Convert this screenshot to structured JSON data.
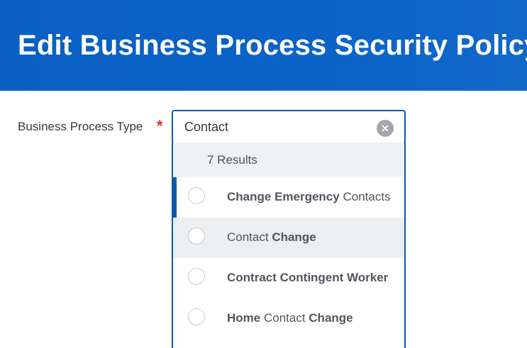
{
  "header": {
    "title": "Edit Business Process Security Policy"
  },
  "form": {
    "field_label": "Business Process Type",
    "required_marker": "*",
    "input_value": "Contact"
  },
  "dropdown": {
    "results_count": "7 Results",
    "options": [
      {
        "parts": [
          {
            "t": "Change Emergency",
            "bold": true
          },
          {
            "t": " Contacts",
            "bold": false
          }
        ]
      },
      {
        "parts": [
          {
            "t": "Contact ",
            "bold": false
          },
          {
            "t": "Change",
            "bold": true
          }
        ]
      },
      {
        "parts": [
          {
            "t": "Contract Contingent Worker",
            "bold": true
          }
        ]
      },
      {
        "parts": [
          {
            "t": "Home",
            "bold": true
          },
          {
            "t": " Contact ",
            "bold": false
          },
          {
            "t": "Change",
            "bold": true
          }
        ]
      }
    ]
  },
  "icons": {
    "clear": "close-icon",
    "radio": "radio-circle-icon"
  },
  "colors": {
    "header_blue": "#0b63c8",
    "focus_border": "#0b5cab",
    "required_red": "#de2f2f",
    "hover_bg": "#eceef0"
  }
}
